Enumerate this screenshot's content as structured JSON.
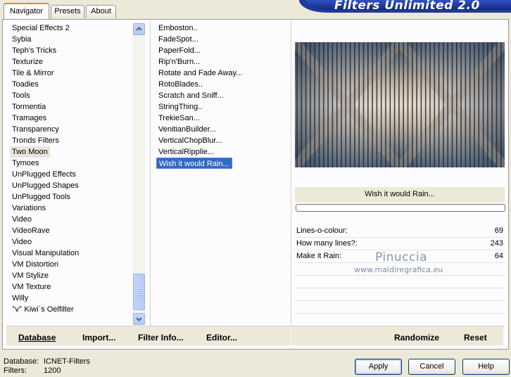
{
  "tabs": [
    {
      "label": "Navigator",
      "active": true
    },
    {
      "label": "Presets",
      "active": false
    },
    {
      "label": "About",
      "active": false
    }
  ],
  "brand": "Filters Unlimited 2.0",
  "categories": [
    "Special Effects 2",
    "Sybia",
    "Teph's Tricks",
    "Texturize",
    "Tile & Mirror",
    "Toadies",
    "Tools",
    "Tormentia",
    "Tramages",
    "Transparency",
    "Tronds Filters",
    "Two Moon",
    "Tymoes",
    "UnPlugged Effects",
    "UnPlugged Shapes",
    "UnPlugged Tools",
    "Variations",
    "Video",
    "VideoRave",
    "Video",
    "Visual Manipulation",
    "VM Distortion",
    "VM Stylize",
    "VM Texture",
    "Willy",
    "°v° Kiwi`s Oelfilter"
  ],
  "selected_category": "Two Moon",
  "filters": [
    "Emboston..",
    "FadeSpot...",
    "PaperFold...",
    "Rip'n'Burn...",
    "Rotate and Fade Away...",
    "RotoBlades..",
    "Scratch and Sniff...",
    "StringThing..",
    "TrekieSan...",
    "VenitianBuilder...",
    "VerticalChopBlur...",
    "VerticalRipplie...",
    "Wish it would Rain..."
  ],
  "selected_filter": "Wish it would Rain...",
  "preview": {
    "filter_name": "Wish it would Rain...",
    "progress": 0
  },
  "params": [
    {
      "name": "Lines-o-colour:",
      "value": "69"
    },
    {
      "name": "How many lines?:",
      "value": "243"
    },
    {
      "name": "Make it Rain:",
      "value": "64"
    }
  ],
  "watermark": {
    "name": "Pinuccia",
    "site": "www.maidiregrafica.eu"
  },
  "toolbar": {
    "database": "Database",
    "import": "Import...",
    "filter_info": "Filter Info...",
    "editor": "Editor...",
    "randomize": "Randomize",
    "reset": "Reset"
  },
  "status": {
    "database_label": "Database:",
    "database_value": "ICNET-Filters",
    "filters_label": "Filters:",
    "filters_value": "1200"
  },
  "buttons": {
    "apply": "Apply",
    "cancel": "Cancel",
    "help": "Help"
  },
  "icons": {
    "scroll_up": "arrow-up-icon",
    "scroll_down": "arrow-down-icon"
  }
}
